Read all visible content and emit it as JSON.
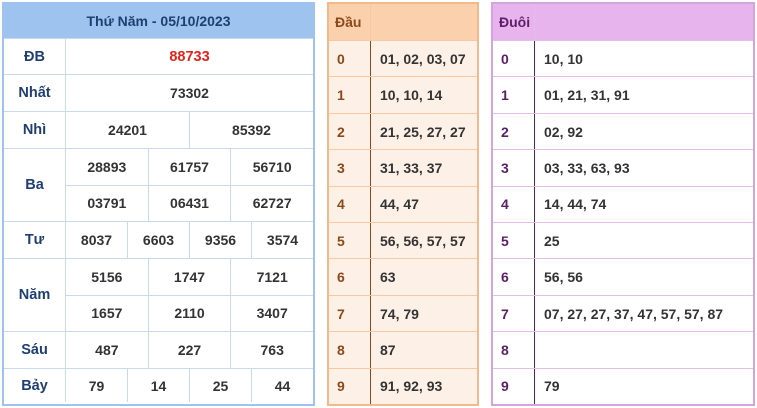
{
  "results": {
    "title": "Thứ Năm - 05/10/2023",
    "rows": [
      {
        "label": "ĐB",
        "lines": [
          [
            "88733"
          ]
        ],
        "special": true
      },
      {
        "label": "Nhất",
        "lines": [
          [
            "73302"
          ]
        ]
      },
      {
        "label": "Nhì",
        "lines": [
          [
            "24201",
            "85392"
          ]
        ]
      },
      {
        "label": "Ba",
        "lines": [
          [
            "28893",
            "61757",
            "56710"
          ],
          [
            "03791",
            "06431",
            "62727"
          ]
        ]
      },
      {
        "label": "Tư",
        "lines": [
          [
            "8037",
            "6603",
            "9356",
            "3574"
          ]
        ]
      },
      {
        "label": "Năm",
        "lines": [
          [
            "5156",
            "1747",
            "7121"
          ],
          [
            "1657",
            "2110",
            "3407"
          ]
        ]
      },
      {
        "label": "Sáu",
        "lines": [
          [
            "487",
            "227",
            "763"
          ]
        ]
      },
      {
        "label": "Bảy",
        "lines": [
          [
            "79",
            "14",
            "25",
            "44"
          ]
        ]
      }
    ]
  },
  "dau": {
    "title": "Đầu",
    "rows": [
      {
        "k": "0",
        "v": "01, 02, 03, 07"
      },
      {
        "k": "1",
        "v": "10, 10, 14"
      },
      {
        "k": "2",
        "v": "21, 25, 27, 27"
      },
      {
        "k": "3",
        "v": "31, 33, 37"
      },
      {
        "k": "4",
        "v": "44, 47"
      },
      {
        "k": "5",
        "v": "56, 56, 57, 57"
      },
      {
        "k": "6",
        "v": "63"
      },
      {
        "k": "7",
        "v": "74, 79"
      },
      {
        "k": "8",
        "v": "87"
      },
      {
        "k": "9",
        "v": "91, 92, 93"
      }
    ]
  },
  "duoi": {
    "title": "Đuôi",
    "rows": [
      {
        "k": "0",
        "v": "10, 10"
      },
      {
        "k": "1",
        "v": "01, 21, 31, 91"
      },
      {
        "k": "2",
        "v": "02, 92"
      },
      {
        "k": "3",
        "v": "03, 33, 63, 93"
      },
      {
        "k": "4",
        "v": "14, 44, 74"
      },
      {
        "k": "5",
        "v": "25"
      },
      {
        "k": "6",
        "v": "56, 56"
      },
      {
        "k": "7",
        "v": "07, 27, 27, 37, 47, 57, 57, 87"
      },
      {
        "k": "8",
        "v": ""
      },
      {
        "k": "9",
        "v": "79"
      }
    ]
  },
  "colors": {
    "special_prize": "#e2241b",
    "results_header": "#9dc3ee",
    "dau_header": "#fbd0ad",
    "duoi_header": "#e8b4ee"
  }
}
